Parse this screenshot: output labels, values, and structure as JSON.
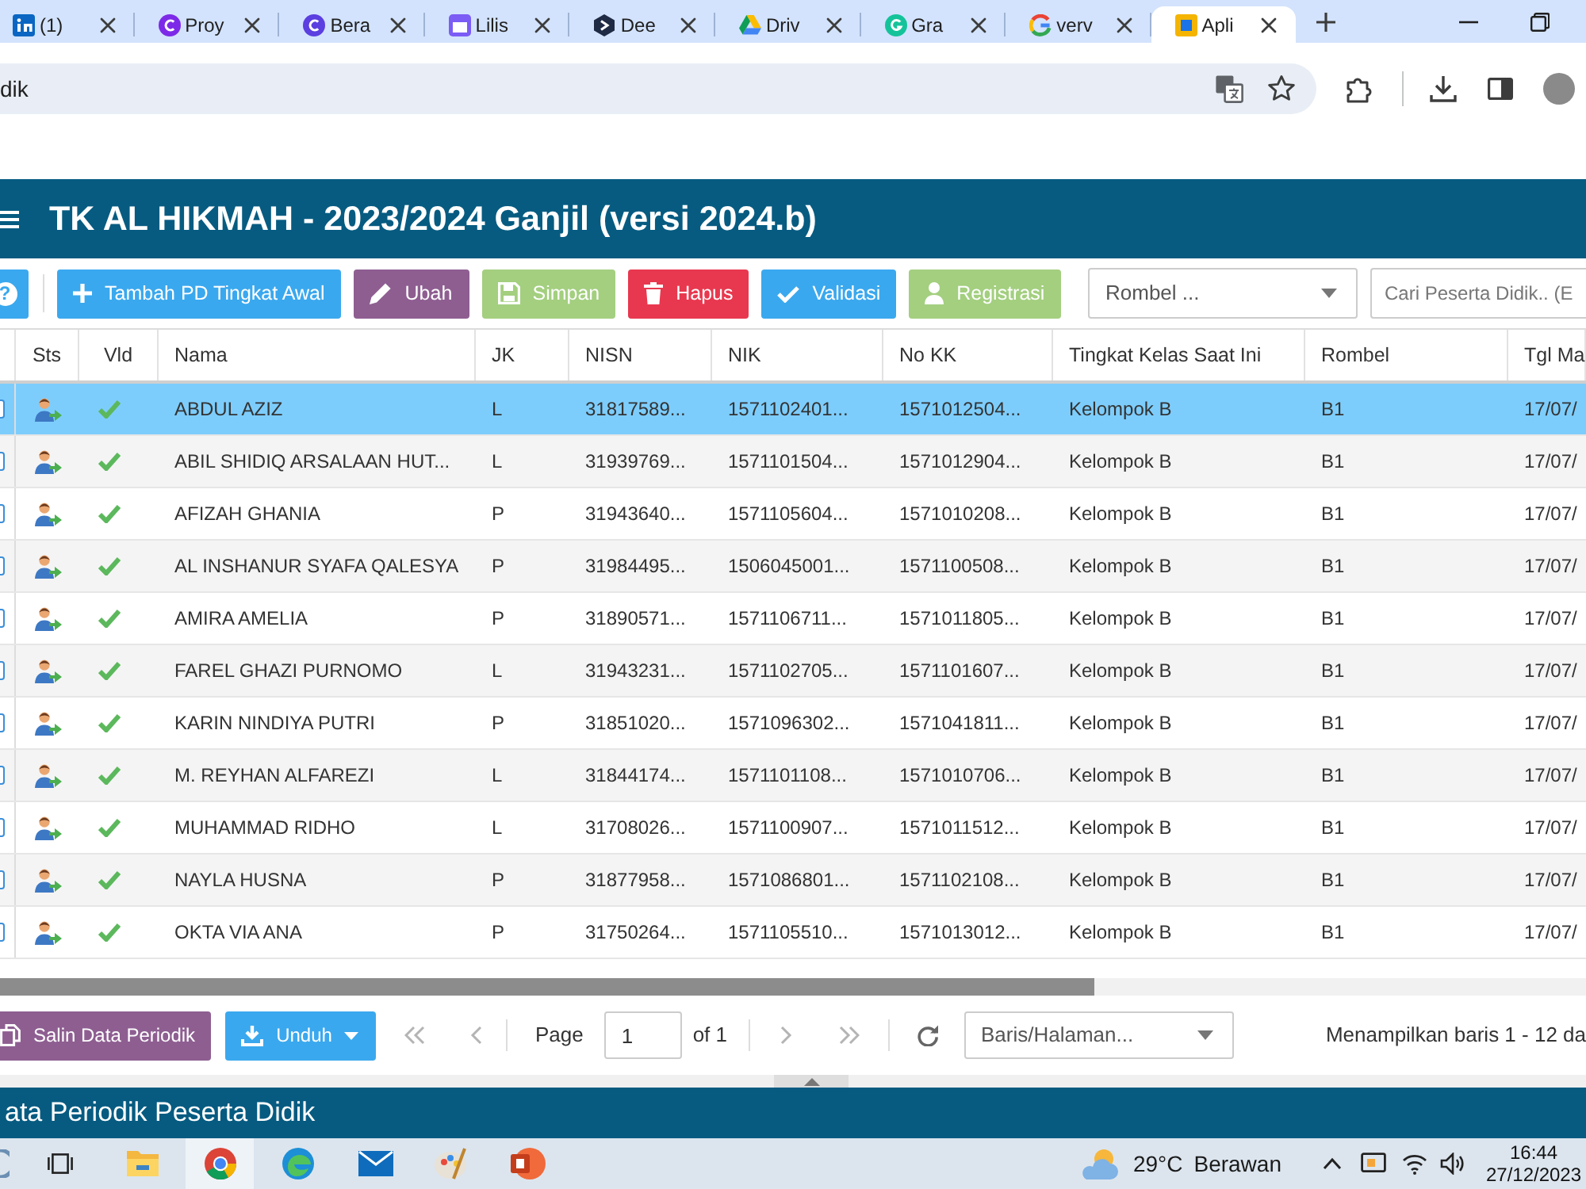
{
  "browser": {
    "tabs": [
      {
        "title": "(1)",
        "selected": false
      },
      {
        "title": "Proy",
        "selected": false
      },
      {
        "title": "Bera",
        "selected": false
      },
      {
        "title": "Lilis",
        "selected": false
      },
      {
        "title": "Dee",
        "selected": false
      },
      {
        "title": "Driv",
        "selected": false
      },
      {
        "title": "Gra",
        "selected": false
      },
      {
        "title": "verv",
        "selected": false
      },
      {
        "title": "Apli",
        "selected": true
      }
    ],
    "address": "dik"
  },
  "app": {
    "title": "TK AL HIKMAH - 2023/2024 Ganjil (versi 2024.b)"
  },
  "toolbar": {
    "help": "?",
    "buttons": [
      {
        "label": "Tambah PD Tingkat Awal",
        "kind": "add",
        "disabled": false
      },
      {
        "label": "Ubah",
        "kind": "edit",
        "disabled": false
      },
      {
        "label": "Simpan",
        "kind": "save",
        "disabled": true
      },
      {
        "label": "Hapus",
        "kind": "delete",
        "disabled": false
      },
      {
        "label": "Validasi",
        "kind": "validate",
        "disabled": false
      },
      {
        "label": "Registrasi",
        "kind": "register",
        "disabled": true
      }
    ],
    "rombel_select": {
      "placeholder": "Rombel ..."
    },
    "search": {
      "placeholder": "Cari Peserta Didik.. (E"
    }
  },
  "table": {
    "icon_columns": [
      "Sts",
      "Vld"
    ],
    "columns": [
      "Nama",
      "JK",
      "NISN",
      "NIK",
      "No KK",
      "Tingkat Kelas Saat Ini",
      "Rombel",
      "Tgl Ma"
    ],
    "rows": [
      {
        "selected": true,
        "valid": true,
        "cells": [
          "ABDUL AZIZ",
          "L",
          "31817589...",
          "1571102401...",
          "1571012504...",
          "Kelompok B",
          "B1",
          "17/07/"
        ]
      },
      {
        "selected": false,
        "valid": true,
        "cells": [
          "ABIL SHIDIQ ARSALAAN HUT...",
          "L",
          "31939769...",
          "1571101504...",
          "1571012904...",
          "Kelompok B",
          "B1",
          "17/07/"
        ]
      },
      {
        "selected": false,
        "valid": true,
        "cells": [
          "AFIZAH GHANIA",
          "P",
          "31943640...",
          "1571105604...",
          "1571010208...",
          "Kelompok B",
          "B1",
          "17/07/"
        ]
      },
      {
        "selected": false,
        "valid": true,
        "cells": [
          "AL INSHANUR SYAFA QALESYA",
          "P",
          "31984495...",
          "1506045001...",
          "1571100508...",
          "Kelompok B",
          "B1",
          "17/07/"
        ]
      },
      {
        "selected": false,
        "valid": true,
        "cells": [
          "AMIRA AMELIA",
          "P",
          "31890571...",
          "1571106711...",
          "1571011805...",
          "Kelompok B",
          "B1",
          "17/07/"
        ]
      },
      {
        "selected": false,
        "valid": true,
        "cells": [
          "FAREL GHAZI PURNOMO",
          "L",
          "31943231...",
          "1571102705...",
          "1571101607...",
          "Kelompok B",
          "B1",
          "17/07/"
        ]
      },
      {
        "selected": false,
        "valid": true,
        "cells": [
          "KARIN NINDIYA PUTRI",
          "P",
          "31851020...",
          "1571096302...",
          "1571041811...",
          "Kelompok B",
          "B1",
          "17/07/"
        ]
      },
      {
        "selected": false,
        "valid": true,
        "cells": [
          "M. REYHAN ALFAREZI",
          "L",
          "31844174...",
          "1571101108...",
          "1571010706...",
          "Kelompok B",
          "B1",
          "17/07/"
        ]
      },
      {
        "selected": false,
        "valid": true,
        "cells": [
          "MUHAMMAD RIDHO",
          "L",
          "31708026...",
          "1571100907...",
          "1571011512...",
          "Kelompok B",
          "B1",
          "17/07/"
        ]
      },
      {
        "selected": false,
        "valid": true,
        "cells": [
          "NAYLA HUSNA",
          "P",
          "31877958...",
          "1571086801...",
          "1571102108...",
          "Kelompok B",
          "B1",
          "17/07/"
        ]
      },
      {
        "selected": false,
        "valid": true,
        "cells": [
          "OKTA VIA ANA",
          "P",
          "31750264...",
          "1571105510...",
          "1571013012...",
          "Kelompok B",
          "B1",
          "17/07/"
        ]
      }
    ]
  },
  "footer": {
    "buttons": [
      {
        "label": "Salin Data Periodik",
        "kind": "copy"
      },
      {
        "label": "Unduh",
        "kind": "download"
      }
    ],
    "pager": {
      "page_label": "Page",
      "page": "1",
      "page_count": "of 1"
    },
    "rows_select": {
      "placeholder": "Baris/Halaman..."
    },
    "summary": "Menampilkan baris 1 - 12 da"
  },
  "panel": {
    "title": "ata Periodik Peserta Didik"
  },
  "taskbar": {
    "weather": {
      "temperature": "29°C",
      "condition": "Berawan"
    },
    "time": "16:44",
    "date": "27/12/2023"
  }
}
